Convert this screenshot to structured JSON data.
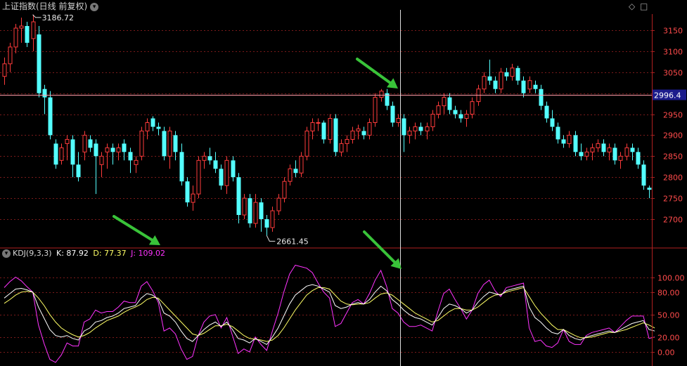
{
  "main": {
    "title": "上证指数(日线 前复权)",
    "dropdown_icon": "chevron-down-icon",
    "tools": [
      "diamond-icon",
      "square-icon"
    ],
    "price_scale": {
      "ticks": [
        "3150",
        "3100",
        "3050",
        "3000",
        "2950",
        "2900",
        "2850",
        "2800",
        "2750",
        "2700"
      ]
    },
    "crosshair_value": "2996.4",
    "high_label": "3186.72",
    "low_label": "2661.45"
  },
  "indicator": {
    "name": "KDJ(9,3,3)",
    "k_label": "K: 87.92",
    "d_label": "D: 77.37",
    "j_label": "J: 109.02",
    "scale": {
      "ticks": [
        "100.00",
        "80.00",
        "50.00",
        "20.00",
        "0.00"
      ]
    }
  },
  "colors": {
    "up": "#ff3b3b",
    "down": "#54ffff",
    "k_line": "#ffffff",
    "d_line": "#ffff66",
    "j_line": "#ff33ff",
    "arrow": "#39c339",
    "grid": "#7a1a1a",
    "crosshair_h": "#ff9aa8",
    "crosshair_v": "#dddddd",
    "value_box": "#1c1c8c"
  },
  "chart_data": {
    "type": "candlestick",
    "price_ylim": [
      2640,
      3200
    ],
    "kdj_ylim": [
      -20,
      130
    ],
    "ohlc": [
      [
        3040,
        3085,
        3020,
        3070
      ],
      [
        3070,
        3120,
        3050,
        3110
      ],
      [
        3110,
        3165,
        3095,
        3155
      ],
      [
        3155,
        3180,
        3120,
        3160
      ],
      [
        3160,
        3170,
        3110,
        3120
      ],
      [
        3130,
        3187,
        3100,
        3170
      ],
      [
        3140,
        3160,
        2990,
        3000
      ],
      [
        3010,
        3020,
        2950,
        2990
      ],
      [
        2990,
        3005,
        2890,
        2900
      ],
      [
        2880,
        2890,
        2820,
        2830
      ],
      [
        2840,
        2880,
        2830,
        2870
      ],
      [
        2880,
        2900,
        2840,
        2890
      ],
      [
        2890,
        2900,
        2800,
        2830
      ],
      [
        2830,
        2860,
        2790,
        2800
      ],
      [
        2860,
        2910,
        2840,
        2900
      ],
      [
        2890,
        2900,
        2860,
        2870
      ],
      [
        2880,
        2890,
        2760,
        2850
      ],
      [
        2830,
        2860,
        2800,
        2850
      ],
      [
        2860,
        2880,
        2820,
        2870
      ],
      [
        2870,
        2880,
        2830,
        2860
      ],
      [
        2860,
        2880,
        2840,
        2870
      ],
      [
        2880,
        2890,
        2840,
        2860
      ],
      [
        2860,
        2870,
        2810,
        2840
      ],
      [
        2830,
        2850,
        2810,
        2840
      ],
      [
        2850,
        2920,
        2840,
        2910
      ],
      [
        2910,
        2940,
        2890,
        2930
      ],
      [
        2940,
        2945,
        2910,
        2920
      ],
      [
        2920,
        2930,
        2900,
        2915
      ],
      [
        2910,
        2920,
        2840,
        2850
      ],
      [
        2850,
        2920,
        2820,
        2910
      ],
      [
        2900,
        2910,
        2840,
        2860
      ],
      [
        2860,
        2880,
        2780,
        2790
      ],
      [
        2790,
        2800,
        2730,
        2740
      ],
      [
        2740,
        2780,
        2720,
        2760
      ],
      [
        2760,
        2850,
        2750,
        2840
      ],
      [
        2840,
        2860,
        2820,
        2850
      ],
      [
        2850,
        2870,
        2830,
        2840
      ],
      [
        2840,
        2860,
        2810,
        2820
      ],
      [
        2820,
        2830,
        2770,
        2780
      ],
      [
        2780,
        2850,
        2760,
        2840
      ],
      [
        2840,
        2850,
        2790,
        2800
      ],
      [
        2800,
        2810,
        2690,
        2710
      ],
      [
        2710,
        2760,
        2700,
        2750
      ],
      [
        2750,
        2760,
        2680,
        2690
      ],
      [
        2690,
        2760,
        2680,
        2740
      ],
      [
        2740,
        2750,
        2670,
        2700
      ],
      [
        2700,
        2710,
        2661,
        2680
      ],
      [
        2680,
        2730,
        2670,
        2720
      ],
      [
        2720,
        2760,
        2710,
        2750
      ],
      [
        2750,
        2800,
        2740,
        2790
      ],
      [
        2790,
        2830,
        2780,
        2820
      ],
      [
        2820,
        2840,
        2800,
        2810
      ],
      [
        2810,
        2860,
        2800,
        2850
      ],
      [
        2850,
        2920,
        2840,
        2910
      ],
      [
        2910,
        2940,
        2890,
        2930
      ],
      [
        2930,
        2940,
        2910,
        2930
      ],
      [
        2930,
        2935,
        2880,
        2890
      ],
      [
        2890,
        2950,
        2880,
        2940
      ],
      [
        2940,
        2950,
        2850,
        2860
      ],
      [
        2860,
        2890,
        2850,
        2880
      ],
      [
        2880,
        2900,
        2860,
        2890
      ],
      [
        2890,
        2920,
        2880,
        2910
      ],
      [
        2910,
        2925,
        2890,
        2915
      ],
      [
        2910,
        2920,
        2890,
        2900
      ],
      [
        2900,
        2940,
        2890,
        2930
      ],
      [
        2930,
        3000,
        2920,
        2990
      ],
      [
        2990,
        3010,
        2980,
        3005
      ],
      [
        3000,
        3010,
        2960,
        2970
      ],
      [
        2970,
        2980,
        2920,
        2930
      ],
      [
        2930,
        2950,
        2920,
        2940
      ],
      [
        2940,
        2950,
        2860,
        2900
      ],
      [
        2900,
        2920,
        2880,
        2910
      ],
      [
        2910,
        2930,
        2890,
        2920
      ],
      [
        2920,
        2930,
        2900,
        2910
      ],
      [
        2910,
        2930,
        2890,
        2920
      ],
      [
        2920,
        2960,
        2910,
        2950
      ],
      [
        2950,
        2980,
        2940,
        2970
      ],
      [
        2970,
        3000,
        2950,
        2990
      ],
      [
        2990,
        3000,
        2950,
        2960
      ],
      [
        2960,
        2970,
        2940,
        2950
      ],
      [
        2950,
        2960,
        2930,
        2940
      ],
      [
        2940,
        2960,
        2920,
        2950
      ],
      [
        2950,
        2990,
        2940,
        2980
      ],
      [
        2980,
        3020,
        2970,
        3010
      ],
      [
        3010,
        3050,
        3000,
        3040
      ],
      [
        3040,
        3080,
        3020,
        3030
      ],
      [
        3030,
        3040,
        3000,
        3010
      ],
      [
        3010,
        3060,
        3000,
        3050
      ],
      [
        3050,
        3060,
        3030,
        3040
      ],
      [
        3040,
        3070,
        3030,
        3060
      ],
      [
        3060,
        3065,
        3020,
        3030
      ],
      [
        3030,
        3040,
        2990,
        3000
      ],
      [
        3010,
        3040,
        3000,
        3030
      ],
      [
        3020,
        3030,
        3000,
        3010
      ],
      [
        3010,
        3020,
        2960,
        2970
      ],
      [
        2970,
        2980,
        2930,
        2940
      ],
      [
        2940,
        2960,
        2910,
        2920
      ],
      [
        2920,
        2930,
        2880,
        2890
      ],
      [
        2890,
        2900,
        2870,
        2880
      ],
      [
        2880,
        2910,
        2870,
        2900
      ],
      [
        2900,
        2910,
        2850,
        2860
      ],
      [
        2860,
        2880,
        2840,
        2850
      ],
      [
        2850,
        2870,
        2840,
        2860
      ],
      [
        2860,
        2880,
        2840,
        2870
      ],
      [
        2870,
        2890,
        2860,
        2880
      ],
      [
        2880,
        2890,
        2850,
        2860
      ],
      [
        2860,
        2880,
        2840,
        2870
      ],
      [
        2870,
        2880,
        2830,
        2840
      ],
      [
        2840,
        2860,
        2820,
        2850
      ],
      [
        2850,
        2880,
        2840,
        2870
      ],
      [
        2870,
        2880,
        2840,
        2860
      ],
      [
        2860,
        2870,
        2820,
        2830
      ],
      [
        2830,
        2840,
        2770,
        2780
      ],
      [
        2775,
        2780,
        2750,
        2770
      ]
    ],
    "k": [
      72,
      78,
      84,
      85,
      83,
      80,
      60,
      45,
      30,
      22,
      20,
      22,
      18,
      16,
      28,
      32,
      40,
      42,
      46,
      48,
      52,
      58,
      60,
      62,
      72,
      78,
      76,
      70,
      52,
      48,
      40,
      28,
      18,
      14,
      22,
      30,
      36,
      40,
      34,
      40,
      30,
      18,
      16,
      12,
      18,
      14,
      10,
      20,
      32,
      48,
      64,
      76,
      82,
      88,
      90,
      88,
      84,
      80,
      62,
      58,
      60,
      64,
      66,
      64,
      70,
      80,
      87.92,
      82,
      70,
      64,
      56,
      50,
      46,
      44,
      40,
      36,
      46,
      58,
      64,
      62,
      58,
      52,
      56,
      66,
      74,
      80,
      78,
      76,
      82,
      84,
      86,
      88,
      60,
      46,
      40,
      32,
      26,
      24,
      30,
      22,
      18,
      16,
      20,
      22,
      24,
      26,
      28,
      26,
      30,
      34,
      38,
      40,
      42,
      30,
      28
    ],
    "d": [
      65,
      70,
      76,
      80,
      81,
      80,
      72,
      62,
      50,
      40,
      32,
      27,
      23,
      20,
      22,
      26,
      32,
      37,
      42,
      45,
      48,
      53,
      57,
      60,
      64,
      70,
      73,
      72,
      64,
      56,
      48,
      40,
      32,
      24,
      22,
      25,
      30,
      35,
      35,
      37,
      34,
      28,
      22,
      18,
      17,
      16,
      14,
      16,
      22,
      32,
      44,
      56,
      66,
      76,
      82,
      86,
      86,
      84,
      76,
      68,
      64,
      63,
      64,
      64,
      66,
      72,
      77.37,
      79,
      76,
      70,
      64,
      58,
      52,
      48,
      44,
      40,
      42,
      48,
      54,
      58,
      58,
      56,
      56,
      60,
      66,
      72,
      76,
      77,
      80,
      82,
      84,
      86,
      74,
      62,
      52,
      44,
      36,
      30,
      30,
      26,
      22,
      19,
      19,
      20,
      22,
      24,
      26,
      26,
      28,
      30,
      33,
      36,
      39,
      36,
      32
    ],
    "j": [
      86,
      94,
      100,
      95,
      87,
      80,
      36,
      11,
      -10,
      -14,
      -4,
      12,
      8,
      8,
      40,
      44,
      56,
      52,
      54,
      54,
      60,
      68,
      66,
      66,
      88,
      94,
      82,
      66,
      28,
      32,
      24,
      4,
      -10,
      -6,
      22,
      40,
      48,
      50,
      32,
      46,
      22,
      -2,
      4,
      0,
      20,
      10,
      2,
      28,
      52,
      80,
      104,
      116,
      114,
      112,
      106,
      92,
      80,
      72,
      34,
      38,
      52,
      66,
      70,
      64,
      78,
      96,
      109.02,
      88,
      58,
      52,
      40,
      34,
      34,
      36,
      32,
      28,
      54,
      78,
      84,
      70,
      58,
      44,
      56,
      78,
      90,
      96,
      82,
      74,
      86,
      88,
      90,
      92,
      32,
      14,
      16,
      8,
      6,
      12,
      30,
      14,
      10,
      10,
      22,
      26,
      28,
      30,
      32,
      26,
      34,
      42,
      48,
      48,
      48,
      18,
      20
    ]
  }
}
